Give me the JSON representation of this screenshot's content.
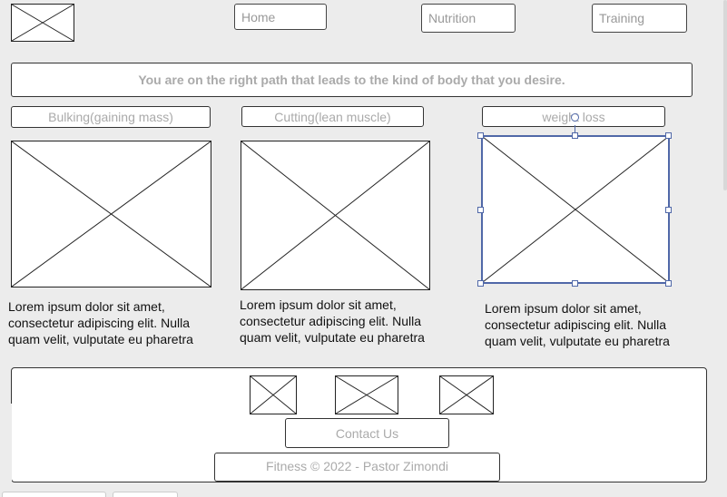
{
  "nav": {
    "home_label": "Home",
    "nutrition_label": "Nutrition",
    "training_label": "Training"
  },
  "banner": {
    "text": "You are on the right path that leads to the kind of body that you desire."
  },
  "categories": [
    {
      "label": "Bulking(gaining mass)",
      "text": "Lorem ipsum dolor sit amet, consectetur adipiscing elit. Nulla quam velit, vulputate eu pharetra"
    },
    {
      "label": "Cutting(lean muscle)",
      "text": "Lorem ipsum dolor sit amet, consectetur adipiscing elit. Nulla quam velit, vulputate eu pharetra"
    },
    {
      "label": "weight loss",
      "text": "Lorem ipsum dolor sit amet, consectetur adipiscing elit. Nulla quam velit, vulputate eu pharetra"
    }
  ],
  "footer": {
    "contact_label": "Contact Us",
    "copyright": "Fitness © 2022 - Pastor Zimondi"
  },
  "icons": {
    "logo": "image-placeholder-icon",
    "category_images": "image-placeholder-icon",
    "social": [
      "image-placeholder-icon",
      "image-placeholder-icon",
      "image-placeholder-icon"
    ]
  },
  "colors": {
    "canvas": "#ececec",
    "selection": "#5068a8",
    "placeholder_text": "#aaaaaa"
  }
}
